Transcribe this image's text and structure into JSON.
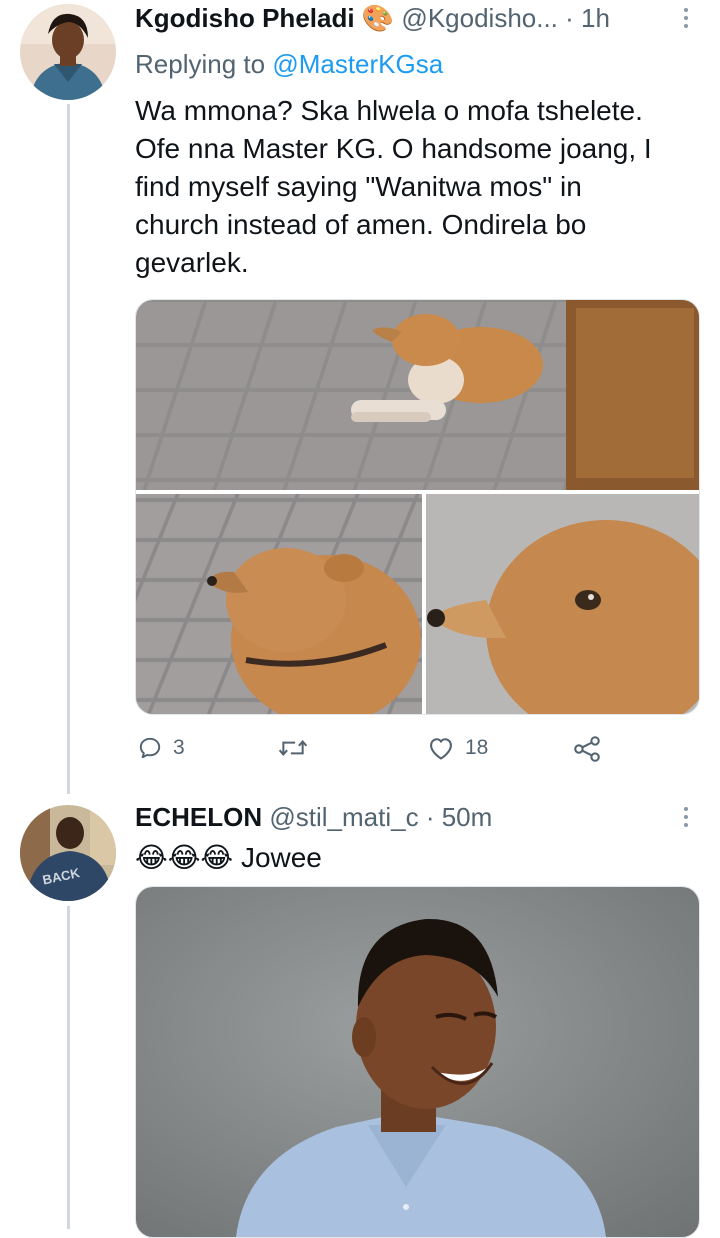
{
  "tweet1": {
    "name": "Kgodisho Pheladi",
    "emoji": "🎨",
    "handle": "@Kgodisho...",
    "dot": "·",
    "time": "1h",
    "replying_label": "Replying to",
    "replying_to": "@MasterKGsa",
    "lines": [
      "Wa mmona? Ska hlwela o mofa tshelete.",
      "Ofe nna Master KG. O handsome joang, I",
      "find myself saying \"Wanitwa mos\" in",
      "church instead of amen. Ondirela bo",
      "gevarlek."
    ],
    "replies": "3",
    "retweets": "",
    "likes": "18"
  },
  "tweet2": {
    "name": "ECHELON",
    "handle": "@stil_mati_c",
    "dot": "·",
    "time": "50m",
    "emojis": "😂😂😂",
    "text": "Jowee",
    "avatar_shirt_text": "BACK"
  },
  "icons": {
    "reply": "reply-icon",
    "retweet": "retweet-icon",
    "like": "heart-icon",
    "share": "share-icon",
    "more": "more-vertical-icon"
  },
  "colors": {
    "link": "#1d9bf0",
    "secondary": "#536471",
    "thread_line": "#cfd9de"
  }
}
